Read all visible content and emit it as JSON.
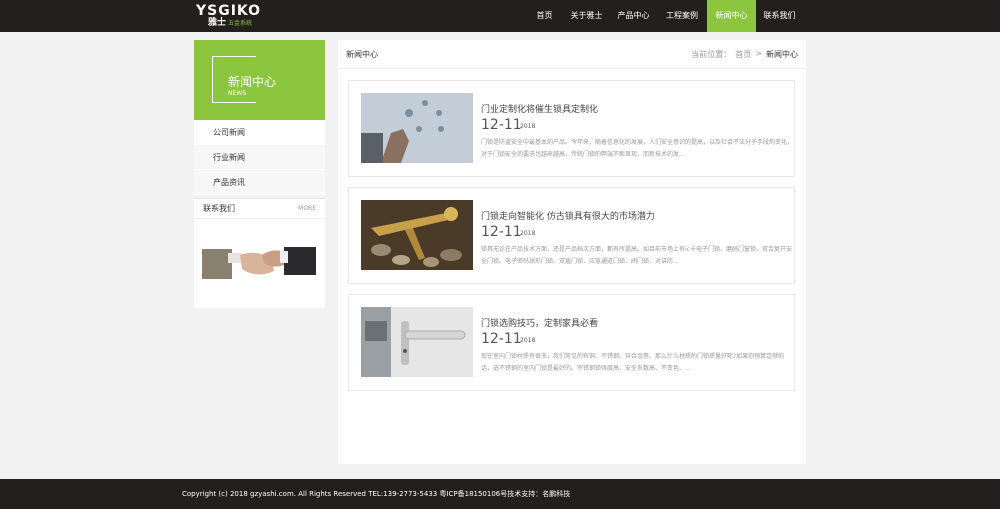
{
  "logo": {
    "main": "YSGIKO",
    "cn": "雅士",
    "sub": "五金系统"
  },
  "nav": [
    {
      "label": "首页",
      "active": false
    },
    {
      "label": "关于雅士",
      "active": false
    },
    {
      "label": "产品中心",
      "active": false
    },
    {
      "label": "工程案例",
      "active": false
    },
    {
      "label": "新闻中心",
      "active": true
    },
    {
      "label": "联系我们",
      "active": false
    }
  ],
  "sidebar": {
    "title": "新闻中心",
    "subtitle": "NEWS",
    "items": [
      {
        "label": "公司新闻"
      },
      {
        "label": "行业新闻"
      },
      {
        "label": "产品资讯"
      }
    ],
    "contact": {
      "title": "联系我们",
      "more": "MORE"
    }
  },
  "main": {
    "title": "新闻中心",
    "breadcrumb": {
      "prefix": "当前位置：",
      "home": "首页",
      "sep": ">",
      "current": "新闻中心"
    },
    "articles": [
      {
        "title": "门业定制化将催生锁具定制化",
        "day": "12-11",
        "year": "2018",
        "desc": "门锁是防盗安全中最基本的产品。今年来，随着信息化的发展，人们安全意识的提高，以及社会不法分子手段的变化，对于门锁安全的要求也越来越高，传统门锁的弊端不断显现，而新技术的发..."
      },
      {
        "title": "门锁走向智能化 仿古锁具有很大的市场潜力",
        "day": "12-11",
        "year": "2018",
        "desc": "锁具无论在产品技术方面，还是产品档次方面，都有所提高。如目前市场上有ic卡电子门锁、磨码门窗锁、双舌复开安全门锁、电子密码球形门锁、双盾门锁、应急通道门锁、阀门锁、对讲防..."
      },
      {
        "title": "门锁选购技巧，定制家具必看",
        "day": "12-11",
        "year": "2018",
        "desc": "现在室内门锁材质有很多，我们常见的有铜、不锈钢、锌合金等。那么什么材质的门锁质量好呢?如果你预算足够的话，选不锈钢的室内门锁是最好的。不锈钢锁强度高、安全系数高、不变色、..."
      }
    ]
  },
  "footer": {
    "text": "Copyright (c) 2018 gzyashi.com. All Rights Reserved TEL:139-2773-5433    粤ICP备18150106号技术支持：名鹏科技"
  },
  "colors": {
    "brand_green": "#8cc63f",
    "header_bg": "#231f1e"
  }
}
